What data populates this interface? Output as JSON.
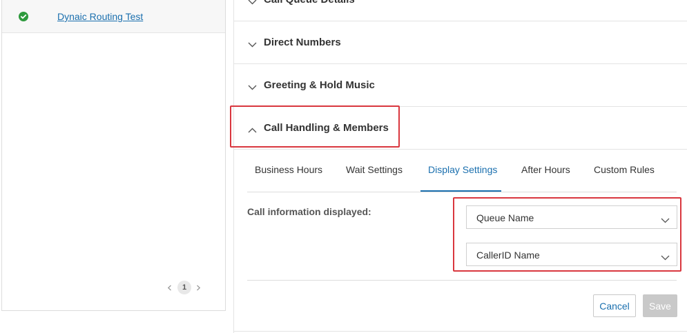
{
  "left": {
    "list_item_label": "Dynaic Routing Test",
    "pager": {
      "current_page": "1"
    }
  },
  "accordion": {
    "call_queue_details": "Call Queue Details",
    "direct_numbers": "Direct Numbers",
    "greeting_hold_music": "Greeting & Hold Music",
    "call_handling_members": "Call Handling & Members"
  },
  "tabs": [
    {
      "label": "Business Hours"
    },
    {
      "label": "Wait Settings"
    },
    {
      "label": "Display Settings"
    },
    {
      "label": "After Hours"
    },
    {
      "label": "Custom Rules"
    }
  ],
  "active_tab": "Display Settings",
  "display_settings": {
    "field_label": "Call information displayed:",
    "select_1_value": "Queue Name",
    "select_2_value": "CallerID Name"
  },
  "buttons": {
    "cancel": "Cancel",
    "save": "Save"
  },
  "colors": {
    "accent": "#1a6fae",
    "highlight": "#d9363e",
    "status_ok": "#2e9a3d",
    "disabled": "#c9c9c9"
  }
}
